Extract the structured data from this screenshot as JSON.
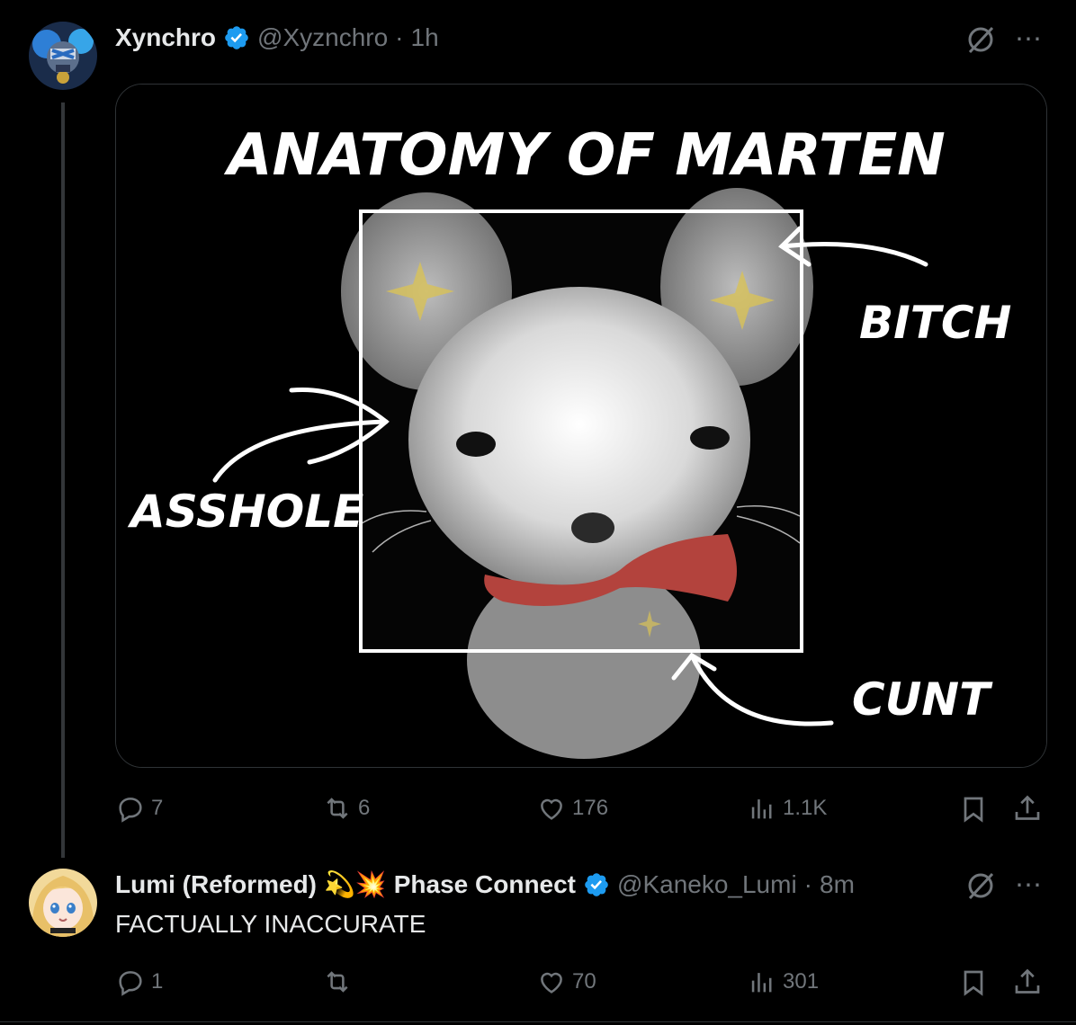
{
  "tweets": [
    {
      "name": "Xynchro",
      "handle": "@Xyznchro",
      "time_sep": "·",
      "time": "1h",
      "verified": true,
      "media": {
        "title": "ANATOMY  OF MARTEN",
        "labels": {
          "ears": "BITCH",
          "cheek": "ASSHOLE",
          "bottom": "CUNT"
        }
      },
      "actions": {
        "replies": "7",
        "reposts": "6",
        "likes": "176",
        "views": "1.1K"
      }
    },
    {
      "name": "Lumi (Reformed)",
      "emojis": "💫💥",
      "org": "Phase Connect",
      "handle": "@Kaneko_Lumi",
      "time_sep": "·",
      "time": "8m",
      "verified": true,
      "text": "FACTUALLY INACCURATE",
      "actions": {
        "replies": "1",
        "reposts": "",
        "likes": "70",
        "views": "301"
      }
    }
  ],
  "icons": {
    "more": "⋯",
    "verified_color": "#1d9bf0"
  }
}
